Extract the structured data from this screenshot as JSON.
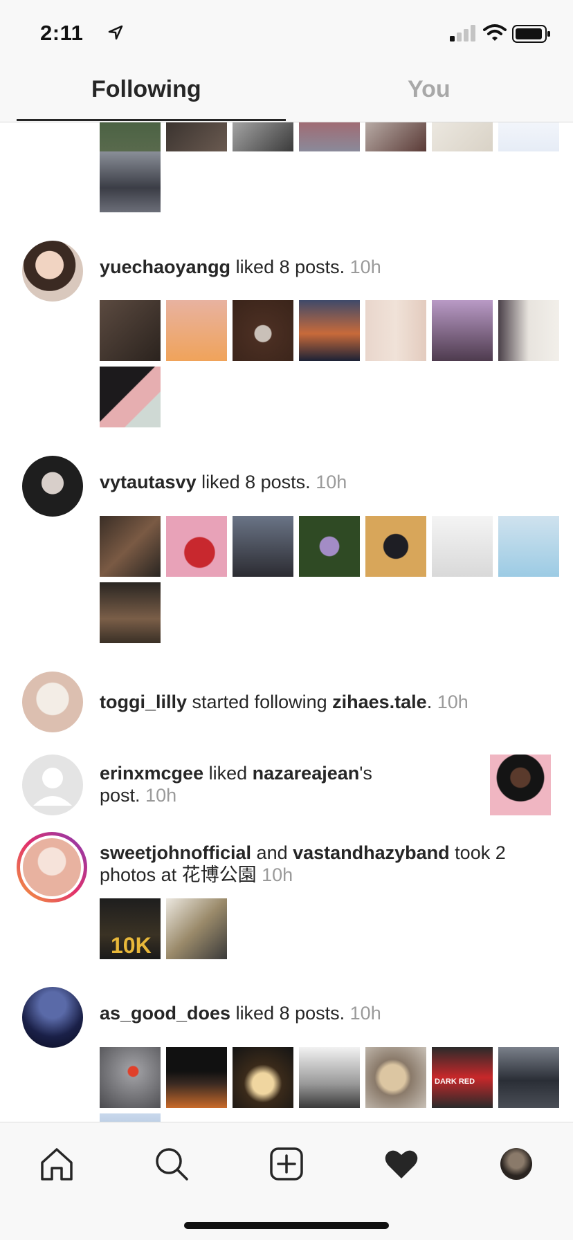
{
  "status_bar": {
    "time": "2:11"
  },
  "tabs": {
    "following": "Following",
    "you": "You"
  },
  "activity": [
    {
      "user": "yuechaoyangg",
      "action": " liked 8 posts. ",
      "time": "10h"
    },
    {
      "user": "vytautasvy",
      "action": " liked 8 posts. ",
      "time": "10h"
    },
    {
      "user": "toggi_lilly",
      "action": " started following ",
      "target": "zihaes.tale",
      "suffix": ". ",
      "time": "10h"
    },
    {
      "user": "erinxmcgee",
      "action": " liked ",
      "target": "nazareajean",
      "suffix": "'s",
      "line2": "post. ",
      "time": "10h"
    },
    {
      "user": "sweetjohnofficial",
      "conj": " and ",
      "user2": "vastandhazyband",
      "action": " took 2",
      "line2": "photos at 花博公園 ",
      "time": "10h"
    },
    {
      "user": "as_good_does",
      "action": " liked 8 posts. ",
      "time": "10h"
    }
  ],
  "thumb_labels": {
    "tenk": "10K",
    "dark_red": "DARK RED"
  },
  "colors": {
    "text": "#262626",
    "muted": "#9a9a9a",
    "accent_ring": "#c13584",
    "bar_bg": "#f8f8f8"
  }
}
